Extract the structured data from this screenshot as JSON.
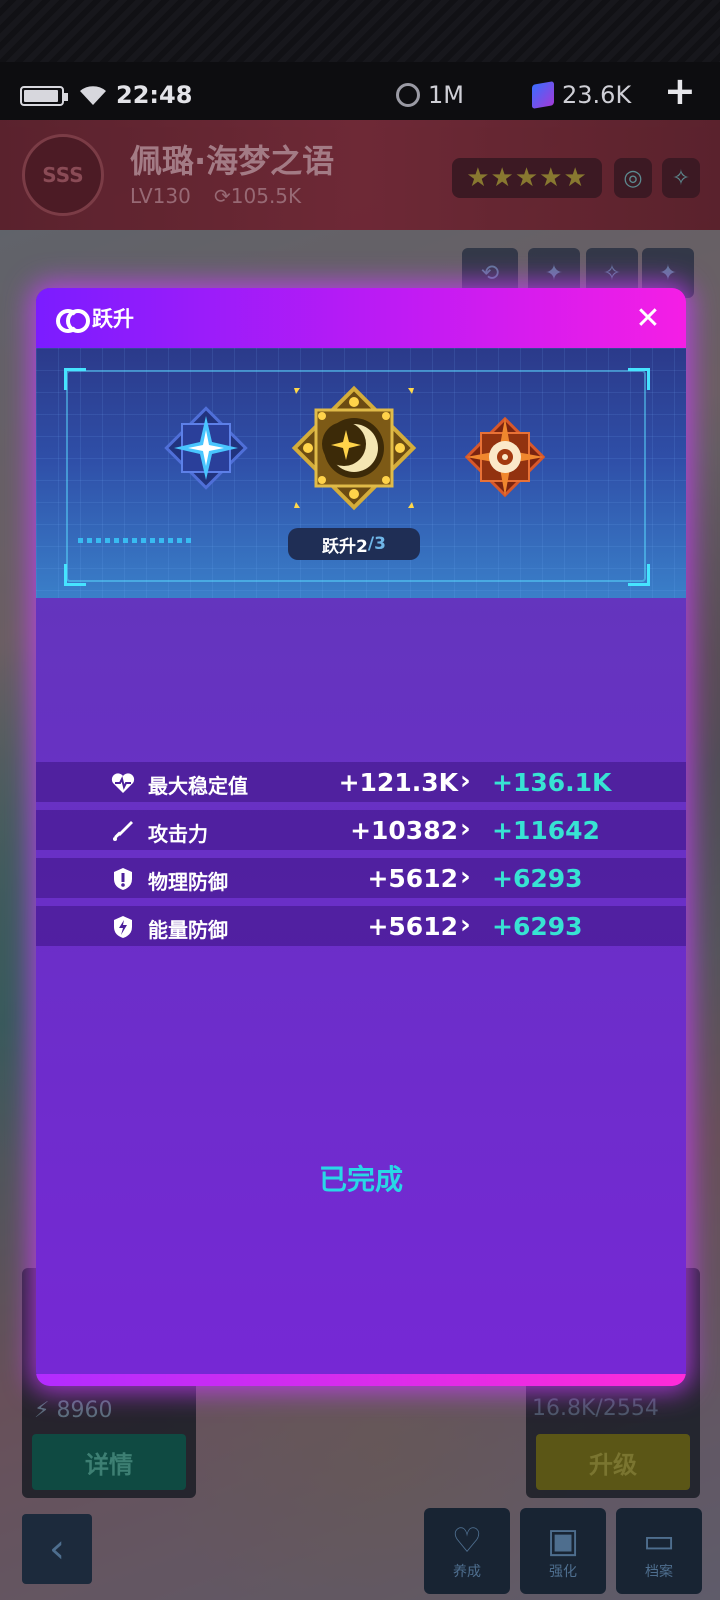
{
  "status_bar": {
    "time": "22:48",
    "currency_1": "1M",
    "currency_2": "23.6K",
    "plus": "+"
  },
  "character": {
    "rank": "SSS",
    "name": "佩璐·海梦之语",
    "level": "LV130",
    "power": "105.5K",
    "stars": "★★★★★"
  },
  "modal": {
    "title": "跃升",
    "close": "✕",
    "ascend_label": "跃升2",
    "ascend_total": "/3",
    "completed": "已完成"
  },
  "stats": [
    {
      "icon": "heart-pulse-icon",
      "label": "最大稳定值",
      "old": "+121.3K",
      "new": "+136.1K"
    },
    {
      "icon": "sword-icon",
      "label": "攻击力",
      "old": "+10382",
      "new": "+11642"
    },
    {
      "icon": "shield-exclaim-icon",
      "label": "物理防御",
      "old": "+5612",
      "new": "+6293"
    },
    {
      "icon": "shield-bolt-icon",
      "label": "能量防御",
      "old": "+5612",
      "new": "+6293"
    }
  ],
  "bottom": {
    "energy": "8960",
    "detail_btn": "详情",
    "exp": "16.8K/2554",
    "upgrade_btn": "升级",
    "nav_cultivate": "养成",
    "nav_enhance": "强化",
    "nav_files": "档案"
  },
  "colors": {
    "accent_cyan": "#37e3d3",
    "header_gradient_start": "#7b1cff",
    "header_gradient_end": "#f51ee5",
    "modal_bg": "#6a2fc7"
  }
}
